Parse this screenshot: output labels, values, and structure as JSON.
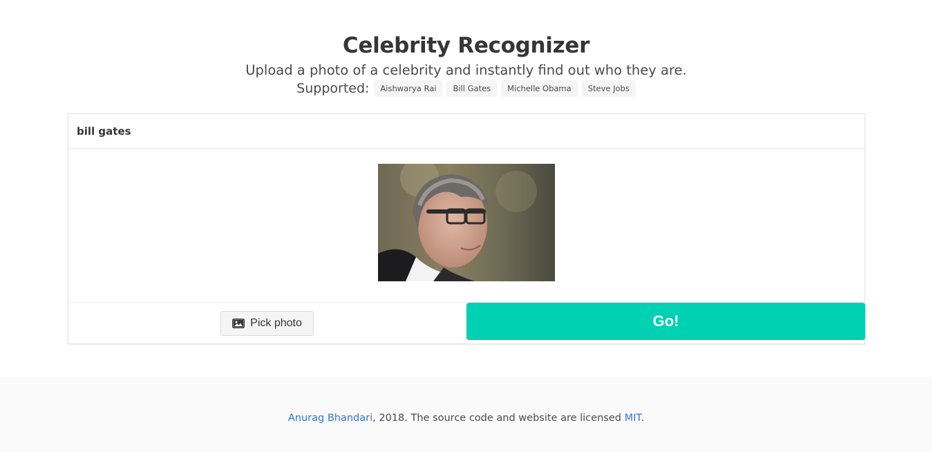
{
  "hero": {
    "title": "Celebrity Recognizer",
    "subtitle": "Upload a photo of a celebrity and instantly find out who they are.",
    "supported_label": "Supported:",
    "supported_tags": [
      "Aishwarya Rai",
      "Bill Gates",
      "Michelle Obama",
      "Steve Jobs"
    ]
  },
  "card": {
    "title": "bill gates",
    "pick_button_label": "Pick photo",
    "go_button_label": "Go!"
  },
  "footer": {
    "author_link": "Anurag Bhandari",
    "text_middle": ", 2018. The source code and website are licensed ",
    "license_link": "MIT",
    "text_end": "."
  },
  "colors": {
    "primary": "#00d1b2",
    "link": "#3273dc",
    "text": "#363636",
    "footer_bg": "#fafafa"
  },
  "icons": {
    "pick_button_icon": "image-icon"
  }
}
